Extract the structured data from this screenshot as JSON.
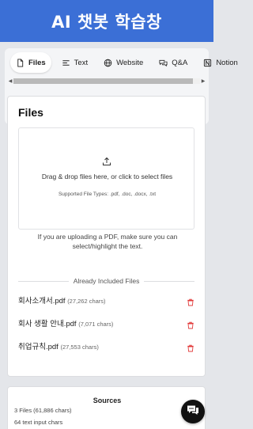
{
  "app": {
    "title": "AI 챗봇 학습창"
  },
  "tabs": [
    {
      "label": "Files",
      "icon": "file-icon",
      "active": true
    },
    {
      "label": "Text",
      "icon": "text-lines-icon",
      "active": false
    },
    {
      "label": "Website",
      "icon": "globe-icon",
      "active": false
    },
    {
      "label": "Q&A",
      "icon": "chat-bubbles-icon",
      "active": false
    },
    {
      "label": "Notion",
      "icon": "notion-icon",
      "active": false
    }
  ],
  "files_panel": {
    "title": "Files",
    "dropzone": {
      "main_text": "Drag & drop files here, or click to select files",
      "supported_text": "Supported File Types: .pdf, .doc, .docx, .txt"
    },
    "note": "If you are uploading a PDF, make sure you can select/highlight the text.",
    "included_label": "Already Included Files",
    "files": [
      {
        "name": "회사소개서.pdf",
        "chars": "(27,262 chars)"
      },
      {
        "name": "회사 생활 안내.pdf",
        "chars": "(7,071 chars)"
      },
      {
        "name": "취업규칙.pdf",
        "chars": "(27,553 chars)"
      }
    ]
  },
  "sources": {
    "title": "Sources",
    "files_summary": "3 Files (61,886 chars)",
    "text_summary": "64 text input chars"
  },
  "colors": {
    "banner": "#3b6fd6",
    "trash": "#e23b3b",
    "fab": "#111111"
  }
}
